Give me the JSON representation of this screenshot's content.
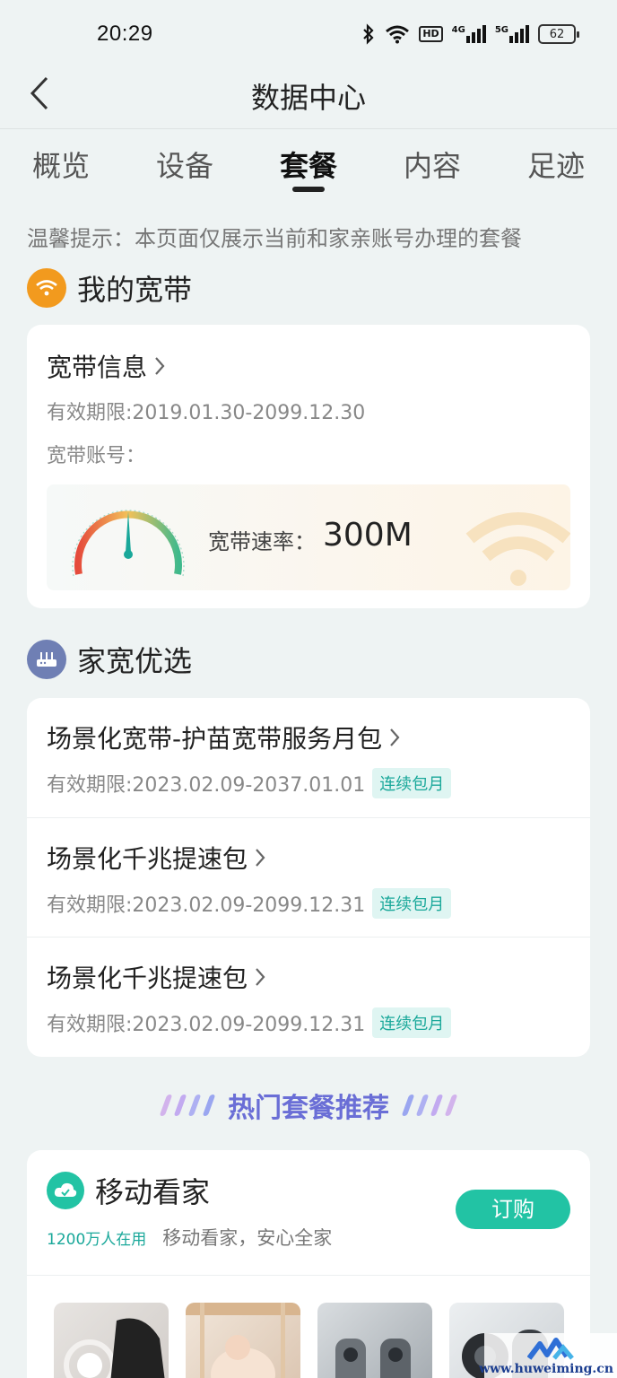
{
  "status": {
    "time": "20:29",
    "battery": "62",
    "hd": "HD",
    "net1": "4G",
    "net2": "5G"
  },
  "header": {
    "title": "数据中心"
  },
  "tabs": [
    {
      "label": "概览"
    },
    {
      "label": "设备"
    },
    {
      "label": "套餐"
    },
    {
      "label": "内容"
    },
    {
      "label": "足迹"
    }
  ],
  "active_tab": "套餐",
  "notice": "温馨提示：本页面仅展示当前和家亲账号办理的套餐",
  "broadband": {
    "section_title": "我的宽带",
    "info_title": "宽带信息",
    "validity": "有效期限:2019.01.30-2099.12.30",
    "account": "宽带账号：",
    "speed_label": "宽带速率：",
    "speed_value": "300M"
  },
  "selected": {
    "section_title": "家宽优选",
    "items": [
      {
        "title": "场景化宽带-护苗宽带服务月包",
        "validity": "有效期限:2023.02.09-2037.01.01",
        "tag": "连续包月"
      },
      {
        "title": "场景化千兆提速包",
        "validity": "有效期限:2023.02.09-2099.12.31",
        "tag": "连续包月"
      },
      {
        "title": "场景化千兆提速包",
        "validity": "有效期限:2023.02.09-2099.12.31",
        "tag": "连续包月"
      }
    ]
  },
  "hot": {
    "title": "热门套餐推荐",
    "product": {
      "name": "移动看家",
      "users": "1200万人在用",
      "slogan": "移动看家，安心全家",
      "order_label": "订购"
    }
  },
  "watermark": "www.huweiming.cn",
  "colors": {
    "accent": "#22c3a4",
    "tag_bg": "#dff5f2",
    "tag_text": "#1aa89a",
    "hot_title": "#6a6ed6",
    "wifi_icon": "#f29a1e",
    "router_icon": "#6f7fb4"
  }
}
